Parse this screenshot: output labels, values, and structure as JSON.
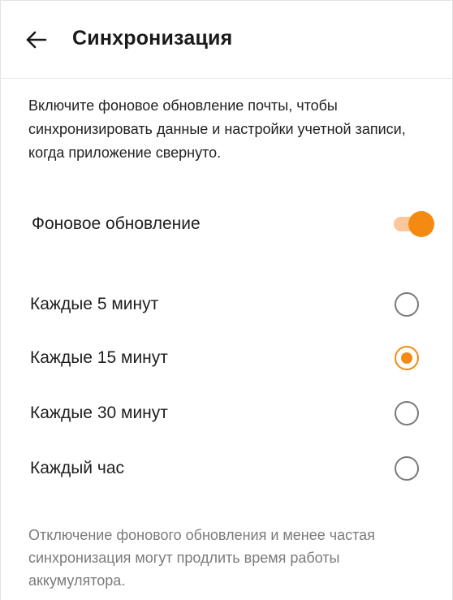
{
  "header": {
    "back_icon": "arrow-left-icon",
    "title": "Синхронизация"
  },
  "description": "Включите фоновое обновление почты, чтобы синхронизировать данные и настройки учетной записи, когда приложение свернуто.",
  "background_refresh": {
    "label": "Фоновое обновление",
    "enabled": true
  },
  "intervals": [
    {
      "label": "Каждые 5 минут",
      "selected": false
    },
    {
      "label": "Каждые 15 минут",
      "selected": true
    },
    {
      "label": "Каждые 30 минут",
      "selected": false
    },
    {
      "label": "Каждый час",
      "selected": false
    }
  ],
  "footnote": "Отключение фонового обновления и менее частая синхронизация могут продлить время работы аккумулятора.",
  "colors": {
    "accent": "#f58a12",
    "accent_track": "#f8c89a",
    "text": "#1f1f1f",
    "muted_text": "#7b7b7b"
  }
}
